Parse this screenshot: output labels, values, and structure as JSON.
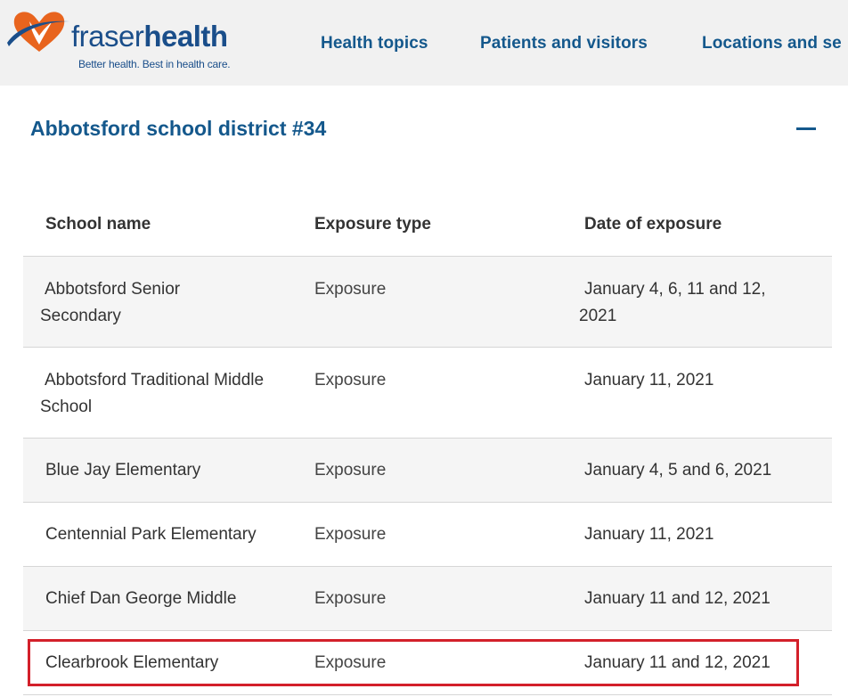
{
  "header": {
    "brand_light": "fraser",
    "brand_bold": "health",
    "tagline": "Better health. Best in health care.",
    "nav": [
      {
        "label": "Health topics"
      },
      {
        "label": "Patients and visitors"
      },
      {
        "label": "Locations and se"
      }
    ]
  },
  "section": {
    "title": "Abbotsford school district #34",
    "collapse_symbol": "minus"
  },
  "table": {
    "headers": [
      "School name",
      "Exposure type",
      "Date of exposure"
    ],
    "rows": [
      {
        "name_l1": "Abbotsford Senior",
        "name_l2": "Secondary",
        "type": "Exposure",
        "date_l1": "January 4, 6, 11 and 12,",
        "date_l2": "2021"
      },
      {
        "name_l1": "Abbotsford Traditional Middle",
        "name_l2": "School",
        "type": "Exposure",
        "date_l1": "January 11, 2021",
        "date_l2": ""
      },
      {
        "name_l1": "Blue Jay Elementary",
        "name_l2": "",
        "type": "Exposure",
        "date_l1": "January 4, 5 and 6, 2021",
        "date_l2": ""
      },
      {
        "name_l1": "Centennial Park Elementary",
        "name_l2": "",
        "type": "Exposure",
        "date_l1": "January 11, 2021",
        "date_l2": ""
      },
      {
        "name_l1": "Chief Dan George Middle",
        "name_l2": "",
        "type": "Exposure",
        "date_l1": "January 11 and 12, 2021",
        "date_l2": ""
      },
      {
        "name_l1": "Clearbrook Elementary",
        "name_l2": "",
        "type": "Exposure",
        "date_l1": "January 11 and 12, 2021",
        "date_l2": ""
      }
    ]
  },
  "colors": {
    "brand_blue": "#14588c",
    "logo_orange": "#e8641e",
    "highlight_red": "#d3202a",
    "header_bg": "#f1f1f1",
    "alt_row_bg": "#f5f5f5"
  }
}
